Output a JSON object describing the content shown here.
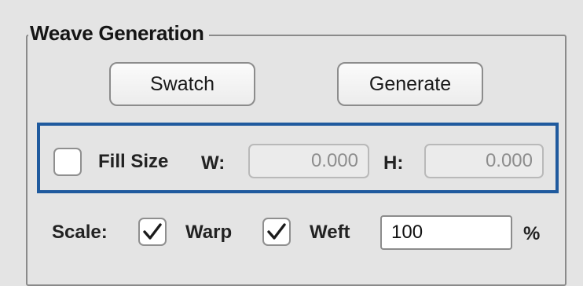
{
  "group": {
    "title": "Weave Generation"
  },
  "buttons": {
    "swatch": "Swatch",
    "generate": "Generate"
  },
  "fill_size": {
    "checkbox_checked": false,
    "label": "Fill Size",
    "w_label": "W:",
    "w_value": "0.000",
    "h_label": "H:",
    "h_value": "0.000"
  },
  "scale": {
    "label": "Scale:",
    "warp_label": "Warp",
    "warp_checked": true,
    "weft_label": "Weft",
    "weft_checked": true,
    "value": "100",
    "unit": "%"
  },
  "colors": {
    "focus_frame": "#1f5a9e",
    "background": "#e4e4e4"
  },
  "icons": {
    "checkmark": "checkmark-icon"
  }
}
